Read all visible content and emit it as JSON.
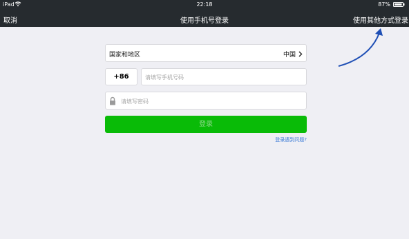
{
  "status_bar": {
    "device": "iPad",
    "time": "22:18",
    "battery": "87%"
  },
  "nav": {
    "cancel": "取消",
    "title": "使用手机号登录",
    "other_login": "使用其他方式登录"
  },
  "form": {
    "region_label": "国家和地区",
    "region_value": "中国",
    "country_code": "+86",
    "phone_placeholder": "请填写手机号码",
    "password_placeholder": "请填写密码",
    "login_button": "登录",
    "help_link": "登录遇到问题?"
  },
  "colors": {
    "nav_background": "#262b2f",
    "page_background": "#efeff4",
    "login_button": "#09bb07",
    "link": "#3a7ad6",
    "annotation_arrow": "#1f4fb5"
  },
  "icons": [
    "wifi-icon",
    "battery-icon",
    "chevron-right-icon",
    "lock-icon",
    "annotation-arrow"
  ]
}
